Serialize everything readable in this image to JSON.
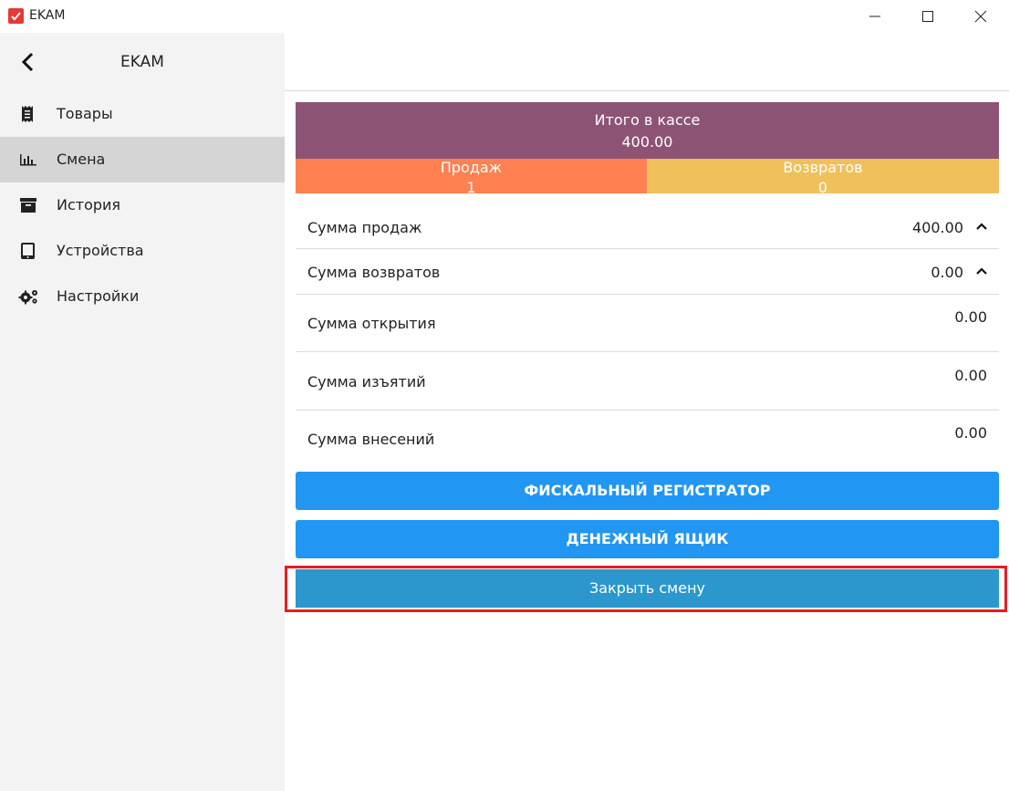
{
  "window": {
    "title": "EKAM",
    "logo_color": "#e53935",
    "controls": [
      "minimize-icon",
      "maximize-icon",
      "close-icon"
    ]
  },
  "sidebar": {
    "title": "EKAM",
    "back_icon": "chevron-left-icon",
    "items": [
      {
        "label": "Товары",
        "icon": "receipt-icon",
        "active": false
      },
      {
        "label": "Смена",
        "icon": "bar-chart-icon",
        "active": true
      },
      {
        "label": "История",
        "icon": "archive-icon",
        "active": false
      },
      {
        "label": "Устройства",
        "icon": "tablet-icon",
        "active": false
      },
      {
        "label": "Настройки",
        "icon": "gears-icon",
        "active": false
      }
    ]
  },
  "summary": {
    "title": "Итого в кассе",
    "value": "400.00",
    "sales_label": "Продаж",
    "sales_value": "1",
    "returns_label": "Возвратов",
    "returns_value": "0",
    "colors": {
      "banner": "#8d5375",
      "sales": "#ff8051",
      "returns": "#f0c05b"
    }
  },
  "rows": [
    {
      "label": "Сумма продаж",
      "value": "400.00",
      "expandable": true
    },
    {
      "label": "Сумма возвратов",
      "value": "0.00",
      "expandable": true
    },
    {
      "label": "Сумма открытия",
      "value": "0.00",
      "expandable": false
    },
    {
      "label": "Сумма изъятий",
      "value": "0.00",
      "expandable": false
    },
    {
      "label": "Сумма внесений",
      "value": "0.00",
      "expandable": false
    }
  ],
  "buttons": {
    "fiscal": "ФИСКАЛЬНЫЙ РЕГИСТРАТОР",
    "cash_drawer": "ДЕНЕЖНЫЙ ЯЩИК",
    "close_shift": "Закрыть смену",
    "accent": "#2196f3",
    "highlight_color": "#e41e25"
  }
}
